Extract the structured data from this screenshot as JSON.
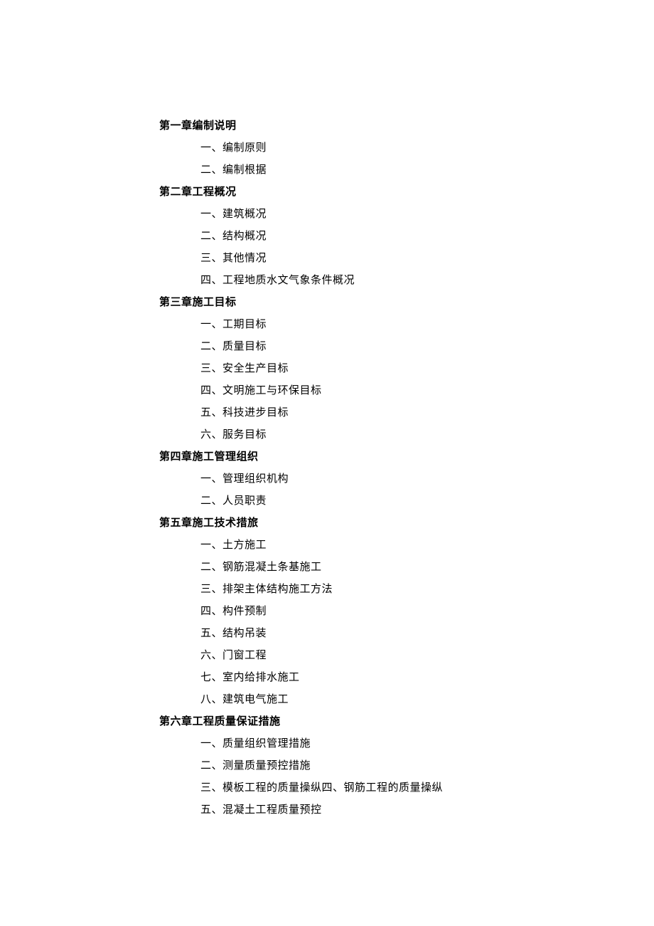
{
  "chapters": [
    {
      "title": "第一章编制说明",
      "items": [
        "一、编制原则",
        "二、编制根据"
      ]
    },
    {
      "title": "第二章工程概况",
      "items": [
        "一、建筑概况",
        "二、结构概况",
        "三、其他情况",
        "四、工程地质水文气象条件概况"
      ]
    },
    {
      "title": "第三章施工目标",
      "items": [
        "一、工期目标",
        "二、质量目标",
        "三、安全生产目标",
        "四、文明施工与环保目标",
        "五、科技进步目标",
        "六、服务目标"
      ]
    },
    {
      "title": "第四章施工管理组织",
      "items": [
        "一、管理组织机构",
        "二、人员职责"
      ]
    },
    {
      "title": "第五章施工技术措旅",
      "items": [
        "一、土方施工",
        "二、钢筋混凝土条基施工",
        "三、排架主体结构施工方法",
        "四、构件预制",
        "五、结构吊装",
        "六、门窗工程",
        "七、室内给排水施工",
        "八、建筑电气施工"
      ]
    },
    {
      "title": "第六章工程质量保证措施",
      "items": [
        "一、质量组织管理措施",
        "二、测量质量预控措施",
        "三、模板工程的质量操纵四、钢筋工程的质量操纵",
        "五、混凝土工程质量预控"
      ]
    }
  ]
}
